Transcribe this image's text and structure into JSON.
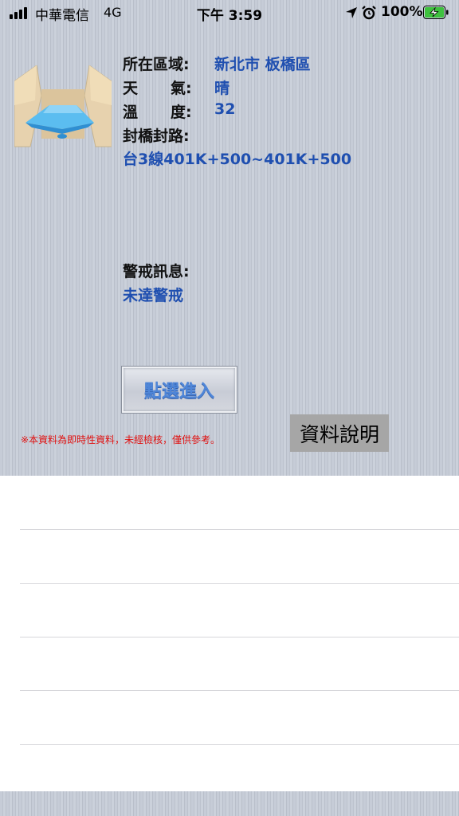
{
  "status_bar": {
    "carrier": "中華電信",
    "network": "4G",
    "time": "下午 3:59",
    "battery_percent": "100%",
    "battery_color": "#3ec13e"
  },
  "bridge_icon": {
    "icon": "bridge-icon",
    "accent": "#4fb2ea"
  },
  "info": {
    "area_label": "所在區域:",
    "area_value": "新北市 板橋區",
    "weather_label_left": "天",
    "weather_label_right": "氣:",
    "weather_value": "晴",
    "temp_label_left": "溫",
    "temp_label_right": "度:",
    "temp_value": "32",
    "closure_label": "封橋封路:",
    "closure_value": "台3線401K+500~401K+500",
    "alert_label": "警戒訊息:",
    "alert_value": "未達警戒"
  },
  "buttons": {
    "enter_label": "點選進入",
    "data_info_label": "資料說明"
  },
  "disclaimer": "※本資料為即時性資料，未經檢核，僅供參考。",
  "list": {
    "rows": [
      "",
      "",
      "",
      "",
      "",
      ""
    ]
  }
}
